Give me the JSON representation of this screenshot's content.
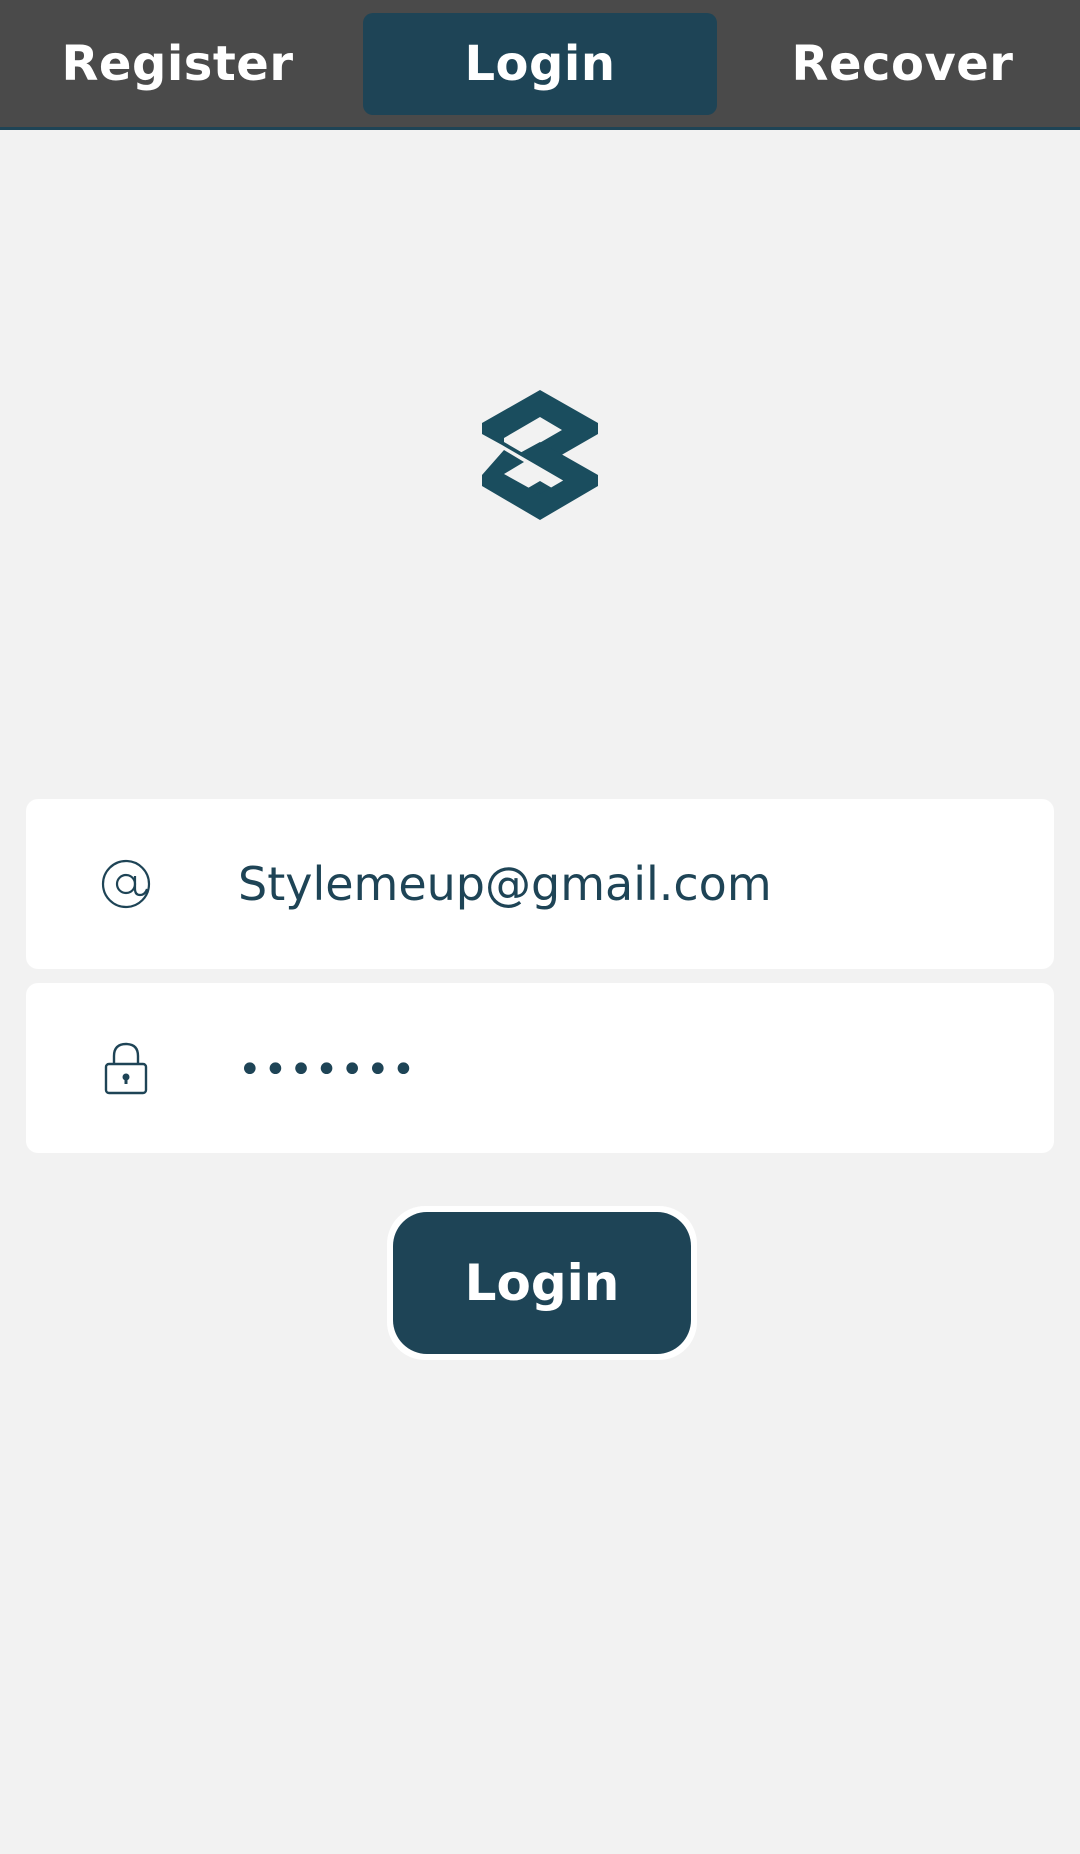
{
  "tabs": {
    "register_label": "Register",
    "login_label": "Login",
    "recover_label": "Recover",
    "active": "Login"
  },
  "logo": {
    "icon": "s-logo-icon",
    "color": "#1a4d5e"
  },
  "form": {
    "email": {
      "icon": "at-sign-icon",
      "value": "Stylemeup@gmail.com"
    },
    "password": {
      "icon": "lock-icon",
      "value": "•••••••"
    },
    "submit_label": "Login"
  },
  "colors": {
    "primary": "#1e4456",
    "topbar": "#4a4a4a",
    "background": "#f2f2f2",
    "field_background": "#ffffff"
  }
}
